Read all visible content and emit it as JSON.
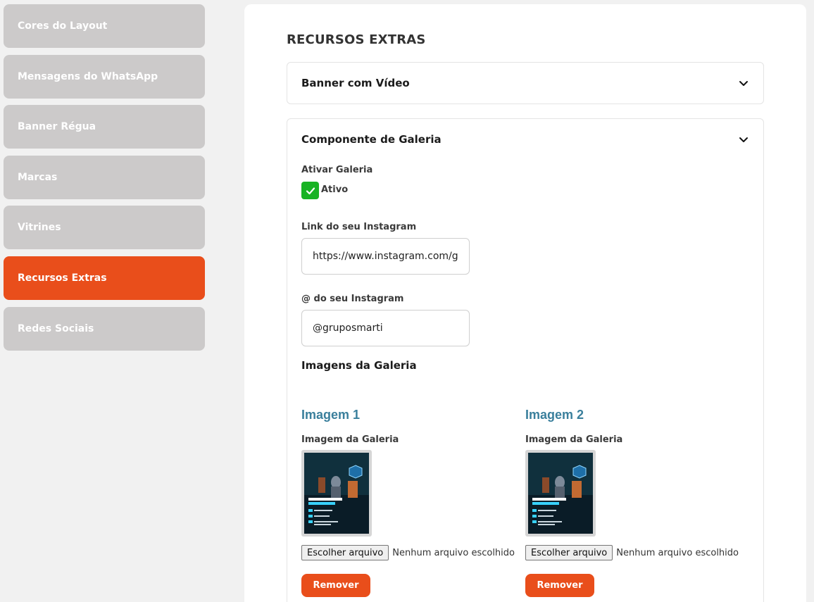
{
  "sidebar": {
    "items": [
      {
        "label": "Cores do Layout"
      },
      {
        "label": "Mensagens do WhatsApp"
      },
      {
        "label": "Banner Régua"
      },
      {
        "label": "Marcas"
      },
      {
        "label": "Vitrines"
      },
      {
        "label": "Recursos Extras",
        "active": true
      },
      {
        "label": "Redes Sociais"
      }
    ]
  },
  "main": {
    "title": "RECURSOS EXTRAS",
    "banner_video": {
      "title": "Banner com Vídeo"
    },
    "gallery": {
      "title": "Componente de Galeria",
      "enable_label": "Ativar Galeria",
      "checkbox_label": "Ativo",
      "checked": true,
      "instagram_link_label": "Link do seu Instagram",
      "instagram_link_value": "https://www.instagram.com/gr",
      "instagram_handle_label": "@ do seu Instagram",
      "instagram_handle_value": "@gruposmarti",
      "images_heading": "Imagens da Galeria",
      "images": [
        {
          "title": "Imagem 1",
          "label": "Imagem da Galeria",
          "choose_button": "Escolher arquivo",
          "file_status": "Nenhum arquivo escolhido",
          "remove_button": "Remover"
        },
        {
          "title": "Imagem 2",
          "label": "Imagem da Galeria",
          "choose_button": "Escolher arquivo",
          "file_status": "Nenhum arquivo escolhido",
          "remove_button": "Remover"
        }
      ]
    }
  },
  "colors": {
    "accent": "#e94e1b",
    "sidebar_inactive": "#cccaca",
    "checkbox_green": "#18b324",
    "image_title": "#3a7f9c"
  },
  "icons": [
    "chevron-down-icon",
    "checkmark-icon"
  ]
}
